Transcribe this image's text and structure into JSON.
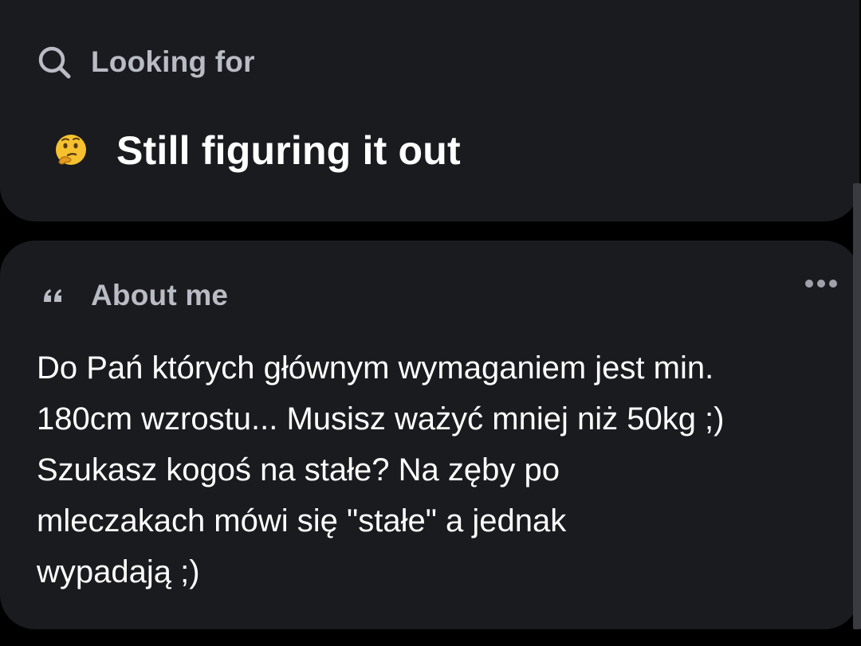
{
  "looking_for": {
    "title": "Looking for",
    "icon": "search-icon",
    "value": "Still figuring it out",
    "value_icon": "thinking-face-emoji"
  },
  "about_me": {
    "title": "About me",
    "icon": "quote-icon",
    "more_icon": "more-dots-icon",
    "bio_lines": [
      "Do Pań których głównym wymaganiem jest min.",
      "180cm wzrostu... Musisz ważyć mniej niż 50kg ;)",
      "Szukasz kogoś na stałe? Na zęby po",
      "mleczakach mówi się \"stałe\" a jednak",
      "wypadają ;)"
    ]
  },
  "colors": {
    "background": "#000000",
    "card": "#1a1b1f",
    "title_text": "#b9bcc4",
    "body_text": "#ffffff",
    "emoji_yellow": "#f6c12f"
  }
}
